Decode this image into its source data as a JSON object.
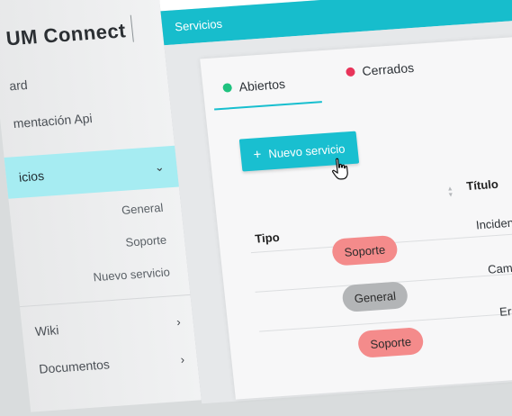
{
  "brand": {
    "name": "UM Connect"
  },
  "sidebar": {
    "items": [
      {
        "label": "ard"
      },
      {
        "label": "mentación Api"
      },
      {
        "label": "icios",
        "expanded": true
      },
      {
        "label": "Wiki"
      },
      {
        "label": "Documentos"
      }
    ],
    "subitems": [
      {
        "label": "General"
      },
      {
        "label": "Soporte"
      },
      {
        "label": "Nuevo servicio"
      }
    ]
  },
  "header": {
    "title": "Servicios"
  },
  "tabs": [
    {
      "label": "Abiertos",
      "dot_color": "#1fc27f",
      "active": true
    },
    {
      "label": "Cerrados",
      "dot_color": "#e8345a",
      "active": false
    }
  ],
  "new_service_button": {
    "label": "Nuevo servicio",
    "icon": "plus-icon"
  },
  "table": {
    "headers": {
      "type": "Tipo",
      "title": "Título"
    },
    "rows": [
      {
        "type": "Soporte",
        "type_color": "#f48b8b",
        "title": "Incidencia co"
      },
      {
        "type": "General",
        "type_color": "#b3b5b7",
        "title": "Cambio de c"
      },
      {
        "type": "Soporte",
        "type_color": "#f48b8b",
        "title": "Error en la"
      }
    ]
  },
  "colors": {
    "accent": "#17bdcc",
    "active_sidebar": "#a6ecf2"
  }
}
